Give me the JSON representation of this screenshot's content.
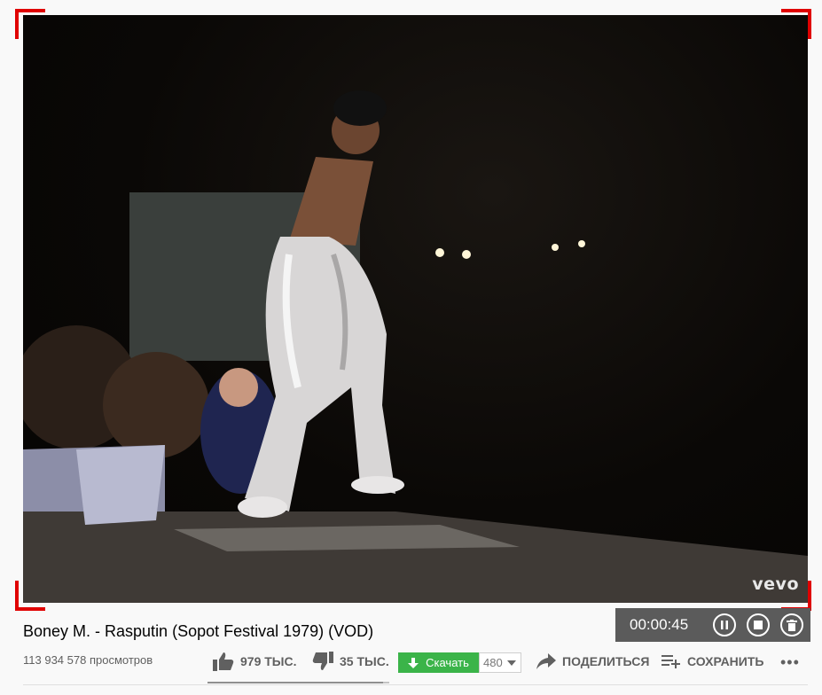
{
  "video": {
    "watermark": "vevo"
  },
  "recorder": {
    "time": "00:00:45"
  },
  "title": "Boney M. - Rasputin (Sopot Festival 1979) (VOD)",
  "views": "113 934 578 просмотров",
  "actions": {
    "like": "979 ТЫС.",
    "dislike": "35 ТЫС.",
    "download": "Скачать",
    "quality": "480",
    "share": "ПОДЕЛИТЬСЯ",
    "save": "СОХРАНИТЬ",
    "more": "•••"
  },
  "like_ratio": 0.965,
  "colors": {
    "download_green": "#3bb449",
    "corner_red": "#e00000",
    "recorder_bg": "#5b5b5b"
  }
}
